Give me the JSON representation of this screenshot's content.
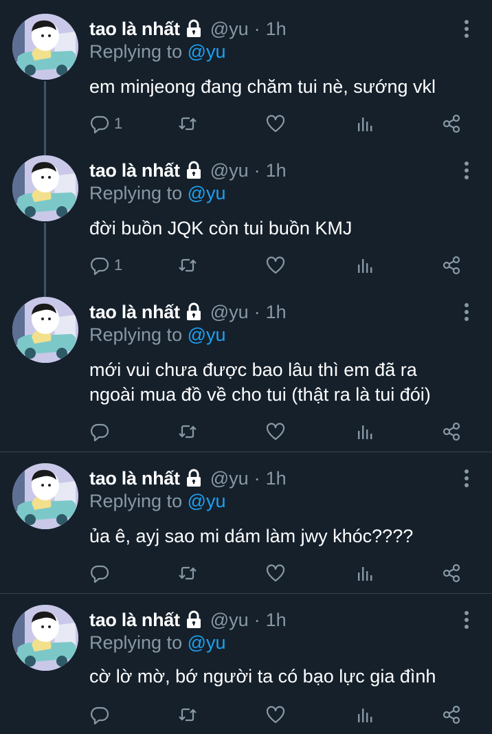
{
  "tweets": [
    {
      "name": "tao là nhất",
      "handle": "@yu",
      "separator": "·",
      "time": "1h",
      "replying_prefix": "Replying to",
      "replying_to": "@yu",
      "text": "em minjeong đang chăm tui nè, sướng vkl",
      "reply_count": "1"
    },
    {
      "name": "tao là nhất",
      "handle": "@yu",
      "separator": "·",
      "time": "1h",
      "replying_prefix": "Replying to",
      "replying_to": "@yu",
      "text": "đời buồn JQK còn tui buồn KMJ",
      "reply_count": "1"
    },
    {
      "name": "tao là nhất",
      "handle": "@yu",
      "separator": "·",
      "time": "1h",
      "replying_prefix": "Replying to",
      "replying_to": "@yu",
      "text_lines": [
        "mới vui chưa được bao lâu thì em đã ra",
        "ngoài mua đồ về cho tui (thật ra là tui đói)"
      ],
      "reply_count": ""
    },
    {
      "name": "tao là nhất",
      "handle": "@yu",
      "separator": "·",
      "time": "1h",
      "replying_prefix": "Replying to",
      "replying_to": "@yu",
      "text": "ủa ê, ayj sao mi dám làm jwy khóc????",
      "reply_count": ""
    },
    {
      "name": "tao là nhất",
      "handle": "@yu",
      "separator": "·",
      "time": "1h",
      "replying_prefix": "Replying to",
      "replying_to": "@yu",
      "text": "cờ lờ mờ, bớ người ta có bạo lực gia đình",
      "reply_count": ""
    }
  ],
  "icons": {
    "lock": "lock-icon",
    "more": "more-vertical-icon",
    "reply": "reply-icon",
    "retweet": "retweet-icon",
    "like": "like-icon",
    "analytics": "analytics-icon",
    "share": "share-icon"
  },
  "colors": {
    "background": "#15202b",
    "secondary_text": "#8899a6",
    "mention": "#1da1f2",
    "divider": "#38444d",
    "thread_line": "#3d5466"
  }
}
